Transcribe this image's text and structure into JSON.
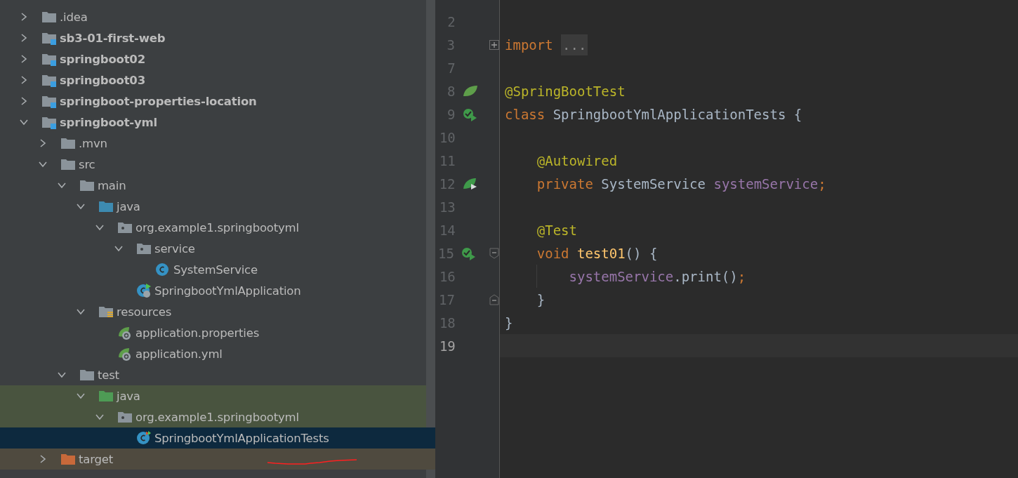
{
  "project_tree": [
    {
      "label": ".idea",
      "kind": "folder",
      "expanded": false,
      "selected": false
    },
    {
      "label": "sb3-01-first-web",
      "kind": "module",
      "expanded": false,
      "selected": false
    },
    {
      "label": "springboot02",
      "kind": "module",
      "expanded": false,
      "selected": false
    },
    {
      "label": "springboot03",
      "kind": "module",
      "expanded": false,
      "selected": false
    },
    {
      "label": "springboot-properties-location",
      "kind": "module",
      "expanded": false,
      "selected": false
    },
    {
      "label": "springboot-yml",
      "kind": "module",
      "expanded": true,
      "selected": false,
      "children": [
        {
          "label": ".mvn",
          "kind": "folder",
          "expanded": false,
          "selected": false
        },
        {
          "label": "src",
          "kind": "folder",
          "expanded": true,
          "selected": false,
          "children": [
            {
              "label": "main",
              "kind": "folder",
              "expanded": true,
              "selected": false,
              "children": [
                {
                  "label": "java",
                  "kind": "source-folder",
                  "expanded": true,
                  "selected": false,
                  "children": [
                    {
                      "label": "org.example1.springbootyml",
                      "kind": "package",
                      "expanded": true,
                      "selected": false,
                      "children": [
                        {
                          "label": "service",
                          "kind": "package",
                          "expanded": true,
                          "selected": false,
                          "children": [
                            {
                              "label": "SystemService",
                              "kind": "class",
                              "selected": false
                            }
                          ]
                        },
                        {
                          "label": "SpringbootYmlApplication",
                          "kind": "app-class",
                          "selected": false
                        }
                      ]
                    }
                  ]
                },
                {
                  "label": "resources",
                  "kind": "resources-folder",
                  "expanded": true,
                  "selected": false,
                  "children": [
                    {
                      "label": "application.properties",
                      "kind": "config",
                      "selected": false
                    },
                    {
                      "label": "application.yml",
                      "kind": "config",
                      "selected": false
                    }
                  ]
                }
              ]
            },
            {
              "label": "test",
              "kind": "folder",
              "expanded": true,
              "selected": false,
              "children": [
                {
                  "label": "java",
                  "kind": "test-folder",
                  "tint": {
                    "kind": "test"
                  },
                  "expanded": true,
                  "selected": false,
                  "children": [
                    {
                      "label": "org.example1.springbootyml",
                      "kind": "package",
                      "tint": {
                        "kind": "test"
                      },
                      "expanded": true,
                      "selected": false,
                      "children": [
                        {
                          "label": "SpringbootYmlApplicationTests",
                          "kind": "test-class",
                          "selected": true
                        }
                      ]
                    }
                  ]
                }
              ]
            }
          ]
        },
        {
          "label": "target",
          "kind": "excluded-folder",
          "tint": {
            "kind": "excluded"
          },
          "expanded": false,
          "selected": false
        }
      ]
    }
  ],
  "editor": {
    "lines": [
      {
        "number": "2"
      },
      {
        "number": "3",
        "fold": {
          "kind": "expand"
        },
        "tokens": [
          {
            "text": "import ",
            "kind": "kw"
          },
          {
            "text": "...",
            "kind": "folded"
          }
        ]
      },
      {
        "number": "7"
      },
      {
        "number": "8",
        "gutter": {
          "kind": "spring"
        },
        "tokens": [
          {
            "text": "@SpringBootTest",
            "kind": "ann"
          }
        ]
      },
      {
        "number": "9",
        "gutter": {
          "kind": "run"
        },
        "tokens": [
          {
            "text": "class ",
            "kind": "kw"
          },
          {
            "text": "SpringbootYmlApplicationTests {",
            "kind": "plain"
          }
        ]
      },
      {
        "number": "10"
      },
      {
        "number": "11",
        "tokens": [
          {
            "text": "    @Autowired",
            "kind": "ann"
          }
        ]
      },
      {
        "number": "12",
        "gutter": {
          "kind": "bean"
        },
        "tokens": [
          {
            "text": "    private ",
            "kind": "kw"
          },
          {
            "text": "SystemService ",
            "kind": "plain"
          },
          {
            "text": "systemService",
            "kind": "field"
          },
          {
            "text": ";",
            "kind": "kw"
          }
        ]
      },
      {
        "number": "13"
      },
      {
        "number": "14",
        "tokens": [
          {
            "text": "    @Test",
            "kind": "ann"
          }
        ]
      },
      {
        "number": "15",
        "gutter": {
          "kind": "run"
        },
        "fold": {
          "kind": "start"
        },
        "tokens": [
          {
            "text": "    void ",
            "kind": "kw"
          },
          {
            "text": "test01",
            "kind": "fn"
          },
          {
            "text": "() {",
            "kind": "plain"
          }
        ]
      },
      {
        "number": "16",
        "tokens": [
          {
            "text": "        systemService",
            "kind": "field"
          },
          {
            "text": ".print()",
            "kind": "plain"
          },
          {
            "text": ";",
            "kind": "kw"
          }
        ]
      },
      {
        "number": "17",
        "fold": {
          "kind": "end"
        },
        "tokens": [
          {
            "text": "    }",
            "kind": "plain"
          }
        ]
      },
      {
        "number": "18",
        "tokens": [
          {
            "text": "}",
            "kind": "plain"
          }
        ]
      },
      {
        "number": "19",
        "current": true
      }
    ]
  }
}
